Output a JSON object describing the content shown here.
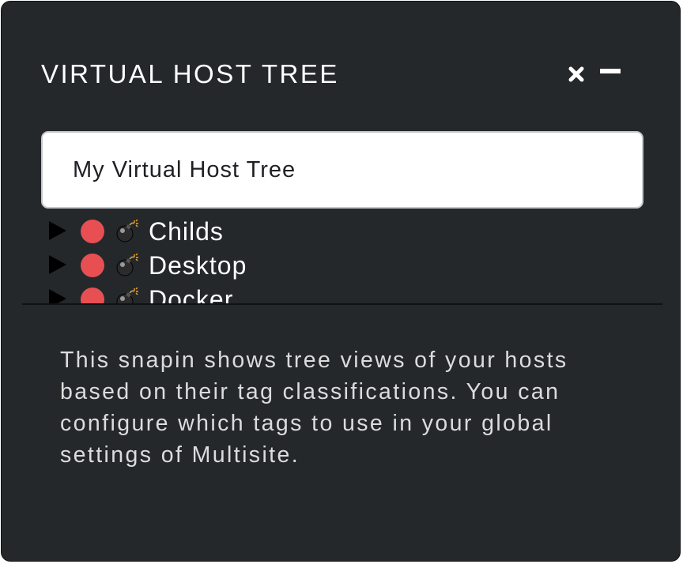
{
  "snapin": {
    "title": "VIRTUAL HOST TREE",
    "close_icon": "close-icon",
    "minimize_icon": "minimize-icon"
  },
  "tree_selector": {
    "value": "My Virtual Host Tree"
  },
  "tree": {
    "items": [
      {
        "label": "Childs",
        "status_color": "#e84f52",
        "icon": "bomb-icon"
      },
      {
        "label": "Desktop",
        "status_color": "#e84f52",
        "icon": "bomb-icon"
      },
      {
        "label": "Docker",
        "status_color": "#e84f52",
        "icon": "bomb-icon"
      }
    ]
  },
  "help": {
    "text": "This snapin shows tree views of your hosts based on their tag classifications. You can configure which tags to use in your global settings of Multisite."
  },
  "colors": {
    "panel_background": "#24282b",
    "status_critical": "#e84f52"
  }
}
